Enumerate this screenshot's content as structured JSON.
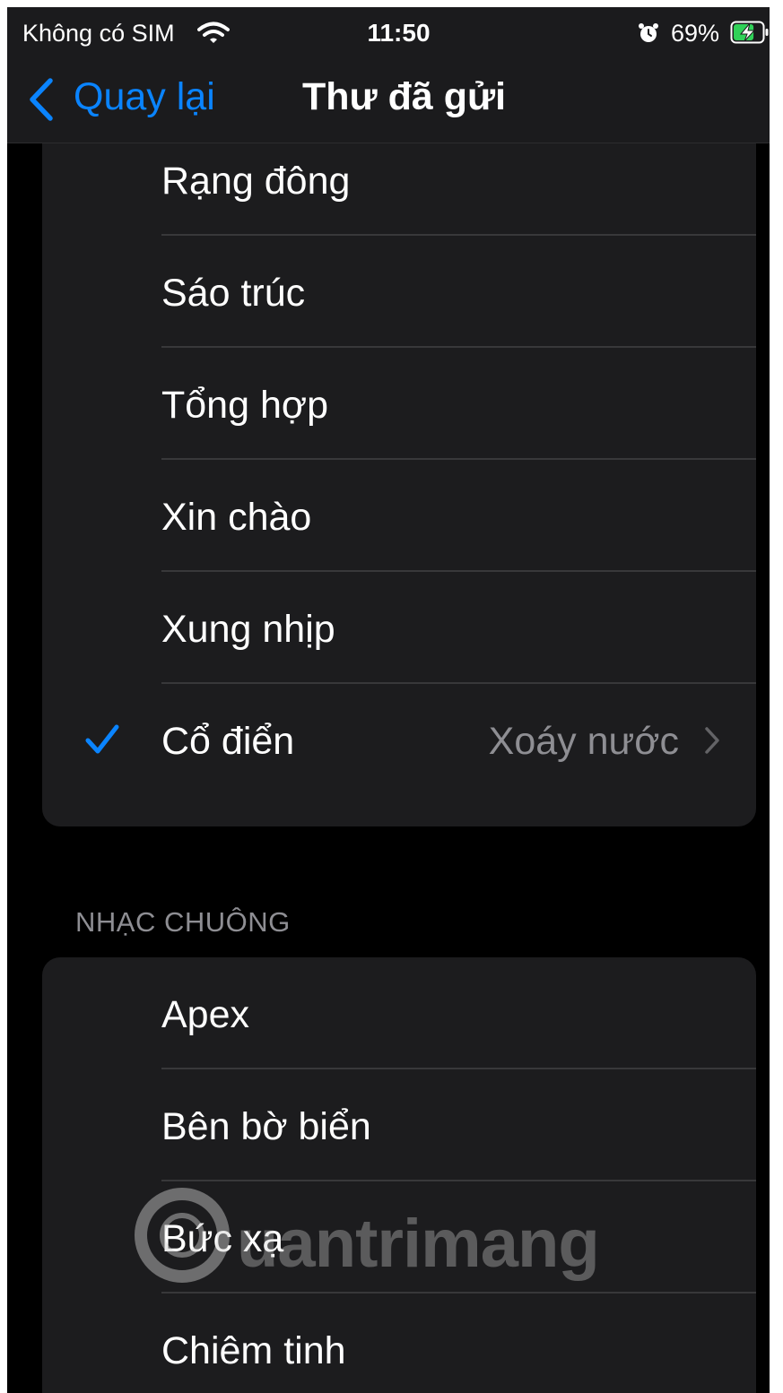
{
  "status_bar": {
    "carrier": "Không có SIM",
    "time": "11:50",
    "battery_percent": "69%",
    "battery_level": 0.69,
    "icons": [
      "wifi-icon",
      "alarm-icon",
      "battery-charging-icon"
    ]
  },
  "nav": {
    "back_label": "Quay lại",
    "title": "Thư đã gửi"
  },
  "top_group": {
    "items": [
      {
        "label": "Rạng đông"
      },
      {
        "label": "Sáo trúc"
      },
      {
        "label": "Tổng hợp"
      },
      {
        "label": "Xin chào"
      },
      {
        "label": "Xung nhịp"
      },
      {
        "label": "Cổ điển",
        "value": "Xoáy nước",
        "checked": true
      }
    ]
  },
  "ringtones": {
    "header": "NHẠC CHUÔNG",
    "items": [
      {
        "label": "Apex"
      },
      {
        "label": "Bên bờ biển"
      },
      {
        "label": "Bức xạ"
      },
      {
        "label": "Chiêm tinh"
      }
    ]
  },
  "watermark": {
    "text": "uantrimang"
  },
  "colors": {
    "accent": "#0a84ff",
    "background": "#000000",
    "cell": "#1c1c1e",
    "secondary_text": "#8e8e93",
    "separator": "#38383a"
  }
}
